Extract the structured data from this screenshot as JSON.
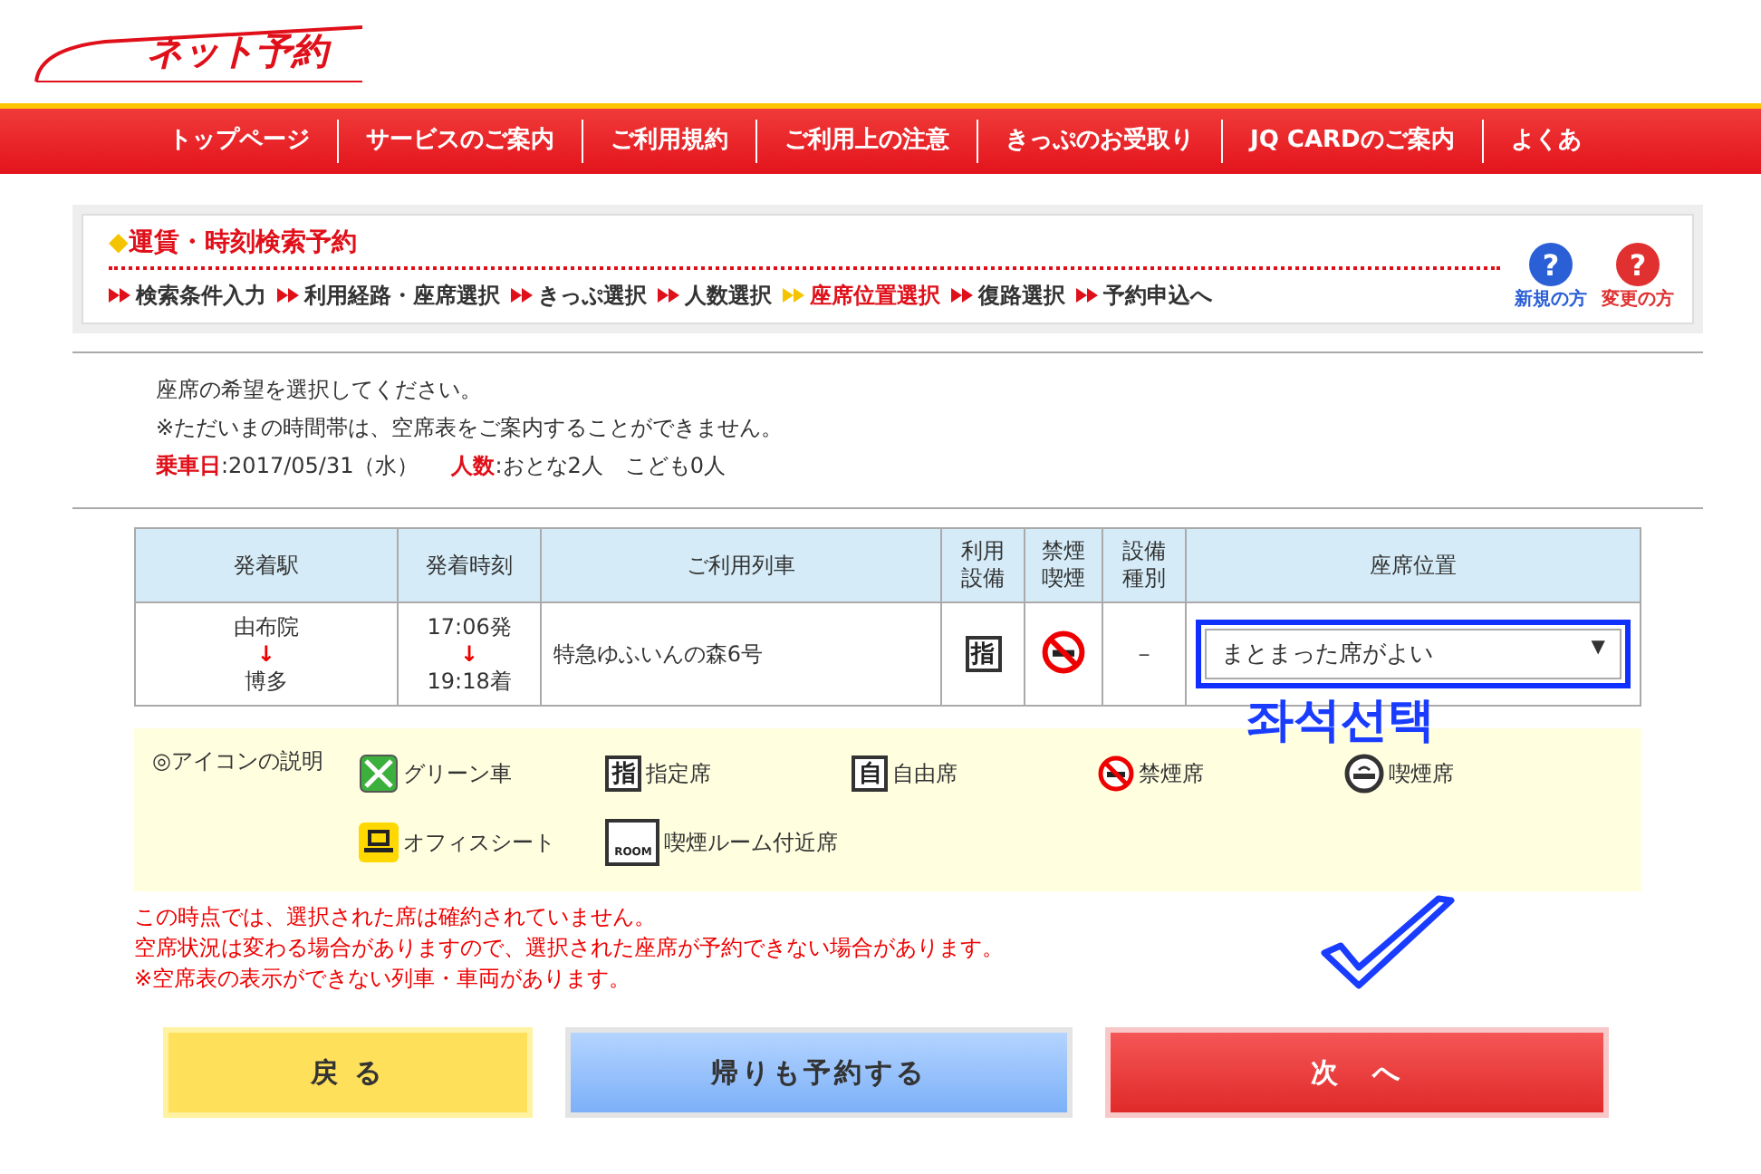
{
  "logo": "ネット予約",
  "nav": [
    "トップページ",
    "サービスのご案内",
    "ご利用規約",
    "ご利用上の注意",
    "きっぷのお受取り",
    "JQ CARDのご案内",
    "よくあ"
  ],
  "panel": {
    "title": "運賃・時刻検索予約",
    "marker": "◆",
    "steps": [
      {
        "label": "検索条件入力",
        "selected": false
      },
      {
        "label": "利用経路・座席選択",
        "selected": false
      },
      {
        "label": "きっぷ選択",
        "selected": false
      },
      {
        "label": "人数選択",
        "selected": false
      },
      {
        "label": "座席位置選択",
        "selected": true
      },
      {
        "label": "復路選択",
        "selected": false
      },
      {
        "label": "予約申込へ",
        "selected": false
      }
    ],
    "help": [
      {
        "glyph": "?",
        "label": "新規の方",
        "color": "#2a5fd6"
      },
      {
        "glyph": "?",
        "label": "変更の方",
        "color": "#e03030"
      }
    ]
  },
  "intro": [
    "座席の希望を選択してください。",
    "※ただいまの時間帯は、空席表をご案内することができません。"
  ],
  "summary": [
    {
      "label": "乗車日",
      "value": ":2017/05/31（水）"
    },
    {
      "label": "人数",
      "value": ":おとな2人　こども0人"
    }
  ],
  "table": {
    "columns": [
      "発着駅",
      "発着時刻",
      "ご利用列車",
      "利用設備",
      "禁煙喫煙",
      "設備種別",
      "座席位置"
    ],
    "rows": [
      {
        "from": "由布院",
        "to": "博多",
        "arrow": "↓",
        "dep": "17:06発",
        "arr": "19:18着",
        "train": "特急ゆふいんの森6号",
        "facility": "指",
        "nonsmoking": true,
        "type": "－",
        "seat": "まとまった席がよい",
        "caret": "▼"
      }
    ]
  },
  "annotation": {
    "text": "좌석선택"
  },
  "legend": {
    "title": "◎アイコンの説明",
    "items": [
      {
        "kind": "green",
        "label": "グリーン車"
      },
      {
        "kind": "char",
        "glyph": "指",
        "label": "指定席"
      },
      {
        "kind": "char",
        "glyph": "自",
        "label": "自由席"
      },
      {
        "kind": "nosmoke",
        "label": "禁煙席"
      },
      {
        "kind": "smoke",
        "label": "喫煙席"
      },
      {
        "kind": "office",
        "label": "オフィスシート"
      },
      {
        "kind": "room",
        "glyph": "ROOM",
        "label": "喫煙ルーム付近席"
      }
    ]
  },
  "notes": [
    "この時点では、選択された席は確約されていません。",
    "空席状況は変わる場合がありますので、選択された座席が予約できない場合があります。",
    "※空席表の表示ができない列車・車両があります。"
  ],
  "buttons": [
    {
      "kind": "back",
      "label": "戻 る"
    },
    {
      "kind": "return",
      "label": "帰りも予約する"
    },
    {
      "kind": "next",
      "label": "次　へ"
    }
  ]
}
